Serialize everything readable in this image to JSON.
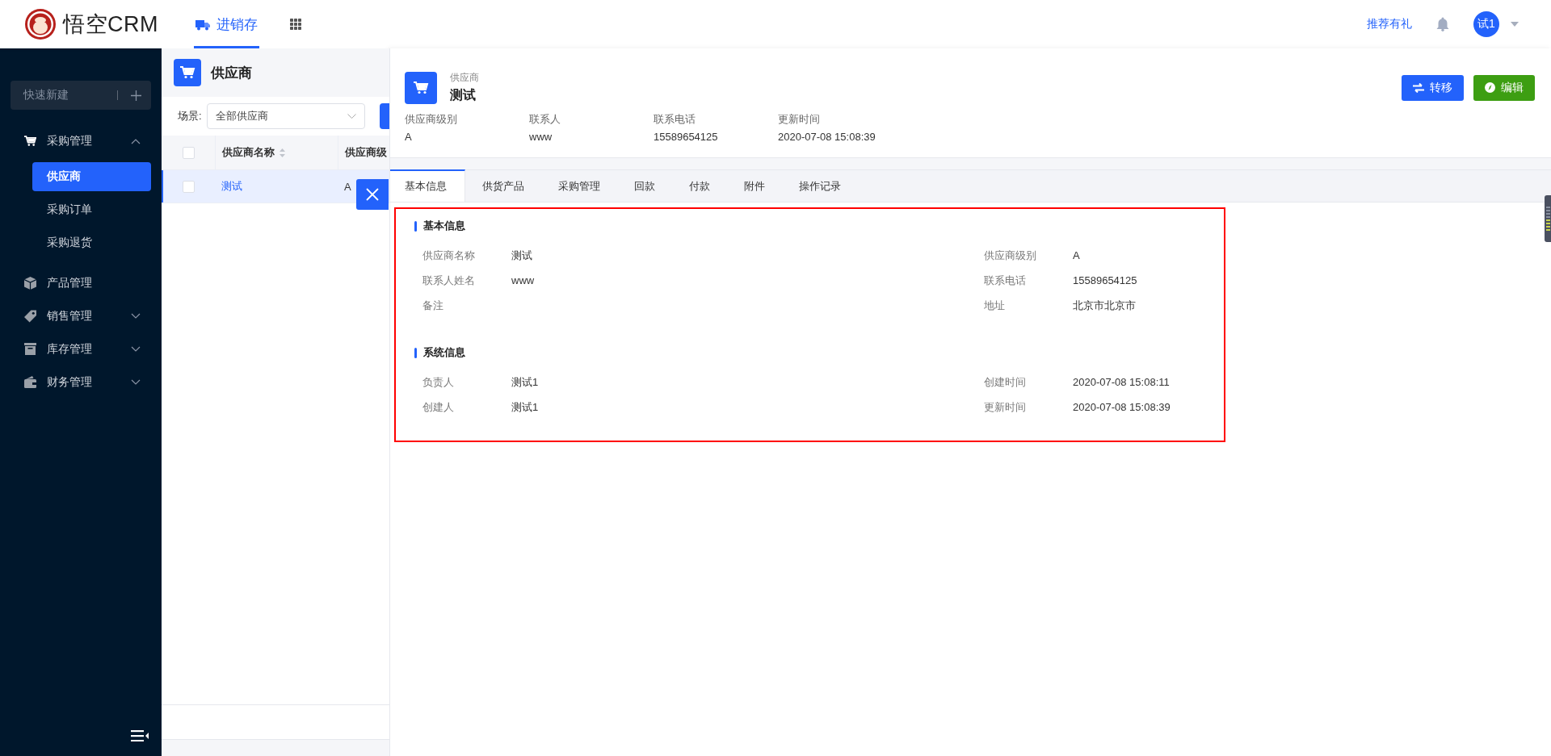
{
  "topbar": {
    "logo_text": "悟空CRM",
    "nav": [
      {
        "label": "进销存",
        "selected": true
      }
    ],
    "referral": "推荐有礼",
    "avatar": "试1"
  },
  "sidebar": {
    "quick_create": "快速新建",
    "items": [
      {
        "label": "采购管理",
        "kind": "group",
        "expanded": true,
        "children": [
          {
            "label": "供应商",
            "selected": true
          },
          {
            "label": "采购订单",
            "selected": false
          },
          {
            "label": "采购退货",
            "selected": false
          }
        ]
      },
      {
        "label": "产品管理",
        "kind": "link"
      },
      {
        "label": "销售管理",
        "kind": "group",
        "expanded": false
      },
      {
        "label": "库存管理",
        "kind": "group",
        "expanded": false
      },
      {
        "label": "财务管理",
        "kind": "group",
        "expanded": false
      }
    ]
  },
  "list": {
    "title": "供应商",
    "scene_label": "场景:",
    "scene_value": "全部供应商",
    "all_checked": false,
    "columns": [
      "供应商名称",
      "供应商级"
    ],
    "rows": [
      {
        "cells": [
          "测试",
          "A"
        ],
        "selected": true,
        "checked": false
      }
    ]
  },
  "detail": {
    "type_label": "供应商",
    "name": "测试",
    "summary": [
      {
        "label": "供应商级别",
        "value": "A"
      },
      {
        "label": "联系人",
        "value": "www"
      },
      {
        "label": "联系电话",
        "value": "15589654125"
      },
      {
        "label": "更新时间",
        "value": "2020-07-08 15:08:39"
      }
    ],
    "actions": [
      {
        "label": "转移",
        "kind": "transfer"
      },
      {
        "label": "编辑",
        "kind": "edit"
      }
    ],
    "tabs": [
      {
        "label": "基本信息",
        "selected": true
      },
      {
        "label": "供货产品",
        "selected": false
      },
      {
        "label": "采购管理",
        "selected": false
      },
      {
        "label": "回款",
        "selected": false
      },
      {
        "label": "付款",
        "selected": false
      },
      {
        "label": "附件",
        "selected": false
      },
      {
        "label": "操作记录",
        "selected": false
      }
    ],
    "sections": [
      {
        "title": "基本信息",
        "fields": [
          {
            "label": "供应商名称",
            "value": "测试"
          },
          {
            "label": "供应商级别",
            "value": "A"
          },
          {
            "label": "联系人姓名",
            "value": "www"
          },
          {
            "label": "联系电话",
            "value": "15589654125"
          },
          {
            "label": "备注"
          },
          {
            "label": "地址",
            "value": "北京市北京市"
          }
        ]
      },
      {
        "title": "系统信息",
        "fields": [
          {
            "label": "负责人",
            "value": "测试1"
          },
          {
            "label": "创建时间",
            "value": "2020-07-08 15:08:11"
          },
          {
            "label": "创建人",
            "value": "测试1"
          },
          {
            "label": "更新时间",
            "value": "2020-07-08 15:08:39"
          }
        ]
      }
    ]
  }
}
